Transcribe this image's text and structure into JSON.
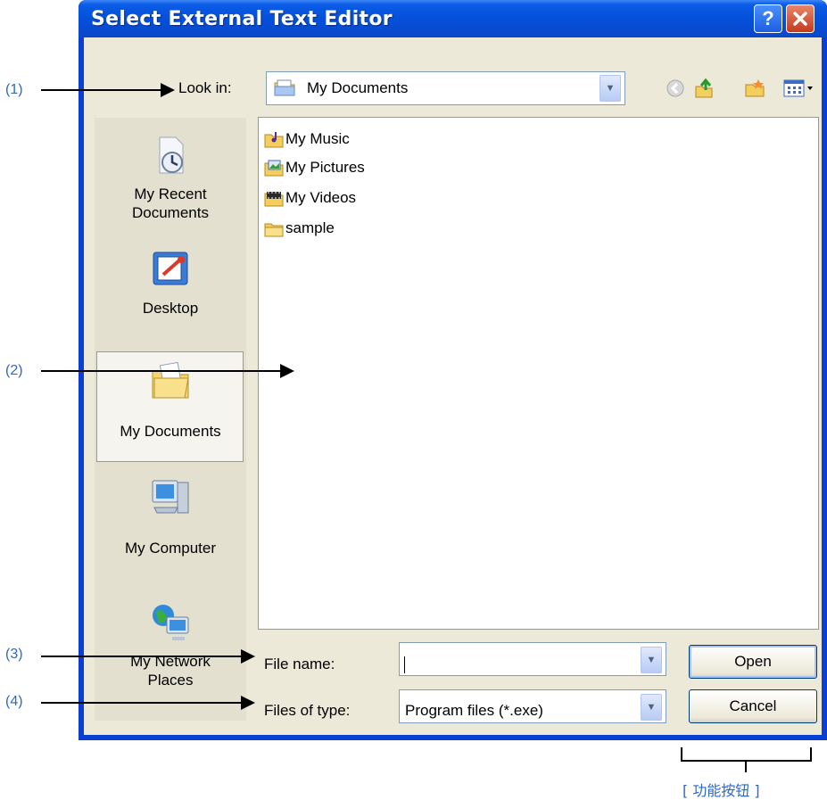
{
  "window": {
    "title": "Select External Text Editor",
    "help_label": "?",
    "close_label": "✕"
  },
  "toolbar": {
    "lookin_label": "Look in:",
    "lookin_value": "My Documents",
    "tools": [
      "back-icon",
      "up-folder-icon",
      "new-folder-icon",
      "view-menu-icon"
    ]
  },
  "places": [
    {
      "label": "My Recent Documents",
      "icon": "recent-documents-icon"
    },
    {
      "label": "Desktop",
      "icon": "desktop-icon"
    },
    {
      "label": "My Documents",
      "icon": "my-documents-icon",
      "selected": true
    },
    {
      "label": "My Computer",
      "icon": "my-computer-icon"
    },
    {
      "label": "My Network Places",
      "icon": "network-places-icon"
    }
  ],
  "files": [
    {
      "name": "My Music",
      "icon": "music-folder-icon"
    },
    {
      "name": "My Pictures",
      "icon": "pictures-folder-icon"
    },
    {
      "name": "My Videos",
      "icon": "videos-folder-icon"
    },
    {
      "name": "sample",
      "icon": "folder-icon"
    }
  ],
  "fields": {
    "filename_label": "File name:",
    "filename_value": "",
    "filetype_label": "Files of type:",
    "filetype_value": "Program files (*.exe)"
  },
  "buttons": {
    "open_label": "Open",
    "cancel_label": "Cancel"
  },
  "annotations": {
    "a1": "(1)",
    "a2": "(2)",
    "a3": "(3)",
    "a4": "(4)",
    "function_buttons": "[ 功能按钮 ]"
  },
  "colors": {
    "titlebar": "#0550da",
    "dialog_bg": "#ece9d8",
    "annotation": "#2b68c8"
  }
}
